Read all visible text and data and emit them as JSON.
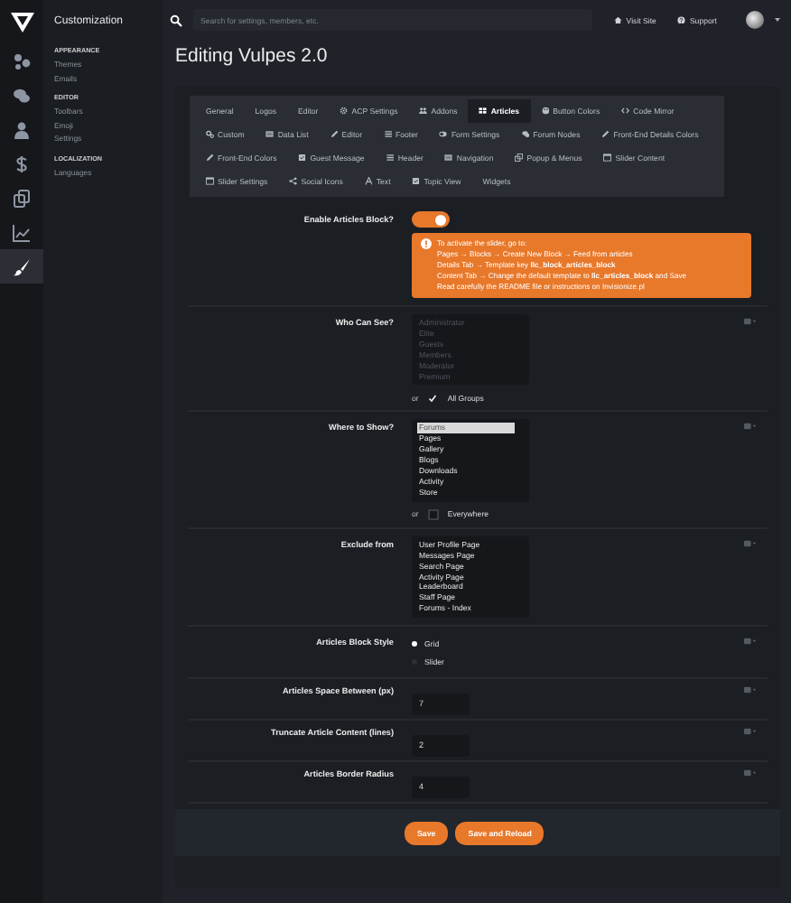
{
  "rail": [
    {
      "kind": "nodes",
      "selected": false
    },
    {
      "kind": "chat",
      "selected": false
    },
    {
      "kind": "user",
      "selected": false
    },
    {
      "kind": "dollar",
      "selected": false
    },
    {
      "kind": "copy",
      "selected": false
    },
    {
      "kind": "chart",
      "selected": false
    },
    {
      "kind": "brush",
      "selected": true
    }
  ],
  "sidebar": {
    "title": "Customization",
    "groups": [
      {
        "heading": "APPEARANCE",
        "items": [
          "Themes",
          "Emails"
        ]
      },
      {
        "heading": "EDITOR",
        "items": [
          "Toolbars",
          "Emoji",
          "Settings"
        ]
      },
      {
        "heading": "LOCALIZATION",
        "items": [
          "Languages"
        ]
      }
    ]
  },
  "topbar": {
    "search": {
      "placeholder": "Search for settings, members, etc."
    },
    "links": [
      {
        "kind": "home",
        "label": "Visit Site"
      },
      {
        "kind": "help",
        "label": "Support"
      }
    ]
  },
  "title": "Editing Vulpes 2.0",
  "tab_rows": [
    {
      "tabs": [
        {
          "label": "General",
          "selected": false
        },
        {
          "label": "Logos",
          "selected": false
        },
        {
          "label": "Editor",
          "selected": false
        },
        {
          "label": "ACP Settings",
          "kind": "gear",
          "selected": false
        },
        {
          "label": "Addons",
          "kind": "people",
          "selected": false
        },
        {
          "label": "Articles",
          "kind": "grid",
          "selected": true
        },
        {
          "label": "Button Colors",
          "kind": "palette",
          "selected": false
        },
        {
          "label": "Code Mirror",
          "kind": "code",
          "selected": false
        }
      ]
    },
    {
      "tabs": [
        {
          "label": "Custom",
          "kind": "gears",
          "selected": false
        },
        {
          "label": "Data List",
          "kind": "list",
          "selected": false
        },
        {
          "label": "Editor",
          "kind": "pencil",
          "selected": false
        },
        {
          "label": "Footer",
          "kind": "bars",
          "selected": false
        },
        {
          "label": "Form Settings",
          "kind": "toggle",
          "selected": false
        },
        {
          "label": "Forum Nodes",
          "kind": "chat",
          "selected": false
        },
        {
          "label": "Front-End Details Colors",
          "kind": "pencil",
          "selected": false
        }
      ]
    },
    {
      "tabs": [
        {
          "label": "Front-End Colors",
          "kind": "pencil",
          "selected": false
        },
        {
          "label": "Guest Message",
          "kind": "square",
          "selected": false
        },
        {
          "label": "Header",
          "kind": "bars",
          "selected": false
        },
        {
          "label": "Navigation",
          "kind": "list",
          "selected": false
        },
        {
          "label": "Popup & Menus",
          "kind": "windows",
          "selected": false
        },
        {
          "label": "Slider Content",
          "kind": "window",
          "selected": false
        }
      ]
    },
    {
      "tabs": [
        {
          "label": "Slider Settings",
          "kind": "window",
          "selected": false
        },
        {
          "label": "Social Icons",
          "kind": "share",
          "selected": false
        },
        {
          "label": "Text",
          "kind": "font",
          "selected": false
        },
        {
          "label": "Topic View",
          "kind": "square",
          "selected": false
        },
        {
          "label": "Widgets",
          "selected": false
        }
      ]
    }
  ],
  "settings": [
    {
      "kind": "toggle",
      "label": "Enable Articles Block?",
      "on": true,
      "notice": [
        "To activate the slider, go to:",
        "Pages → Blocks → Create New Block → Feed from articles",
        "Details Tab → Template key **llc_block_articles_block**",
        "Content Tab → Change the default template to **llc_articles_block** and Save",
        "Read carefully the README file or instructions on Invisionize.pl"
      ]
    },
    {
      "kind": "list",
      "label": "Who Can See?",
      "disabled": true,
      "options": [
        {
          "label": "Administrator",
          "selected": false
        },
        {
          "label": "Elite",
          "selected": false
        },
        {
          "label": "Guests",
          "selected": false
        },
        {
          "label": "Members",
          "selected": false
        },
        {
          "label": "Moderator",
          "selected": false
        },
        {
          "label": "Premium",
          "selected": false
        }
      ],
      "alt": {
        "or": "or",
        "label": "All Groups",
        "checked": true
      }
    },
    {
      "kind": "list",
      "label": "Where to Show?",
      "disabled": false,
      "options": [
        {
          "label": "Forums",
          "selected": true
        },
        {
          "label": "Pages",
          "selected": false
        },
        {
          "label": "Gallery",
          "selected": false
        },
        {
          "label": "Blogs",
          "selected": false
        },
        {
          "label": "Downloads",
          "selected": false
        },
        {
          "label": "Activity",
          "selected": false
        },
        {
          "label": "Store",
          "selected": false
        }
      ],
      "alt": {
        "or": "or",
        "label": "Everywhere",
        "checked": false
      }
    },
    {
      "kind": "list",
      "label": "Exclude from",
      "disabled": false,
      "options": [
        {
          "label": "User Profile Page",
          "selected": false
        },
        {
          "label": "Messages Page",
          "selected": false
        },
        {
          "label": "Search Page",
          "selected": false
        },
        {
          "label": "Activity Page",
          "selected": false
        },
        {
          "label": "Leaderboard",
          "selected": false
        },
        {
          "label": "Staff Page",
          "selected": false
        },
        {
          "label": "Forums - Index",
          "selected": false
        }
      ]
    },
    {
      "kind": "radio",
      "label": "Articles Block Style",
      "options": [
        {
          "label": "Grid",
          "selected": true
        },
        {
          "label": "Slider",
          "selected": false
        }
      ]
    },
    {
      "kind": "number",
      "label": "Articles Space Between (px)",
      "value": "7"
    },
    {
      "kind": "number",
      "label": "Truncate Article Content (lines)",
      "value": "2"
    },
    {
      "kind": "number",
      "label": "Articles Border Radius",
      "value": "4"
    }
  ],
  "buttons": [
    {
      "label": "Save"
    },
    {
      "label": "Save and Reload"
    }
  ]
}
